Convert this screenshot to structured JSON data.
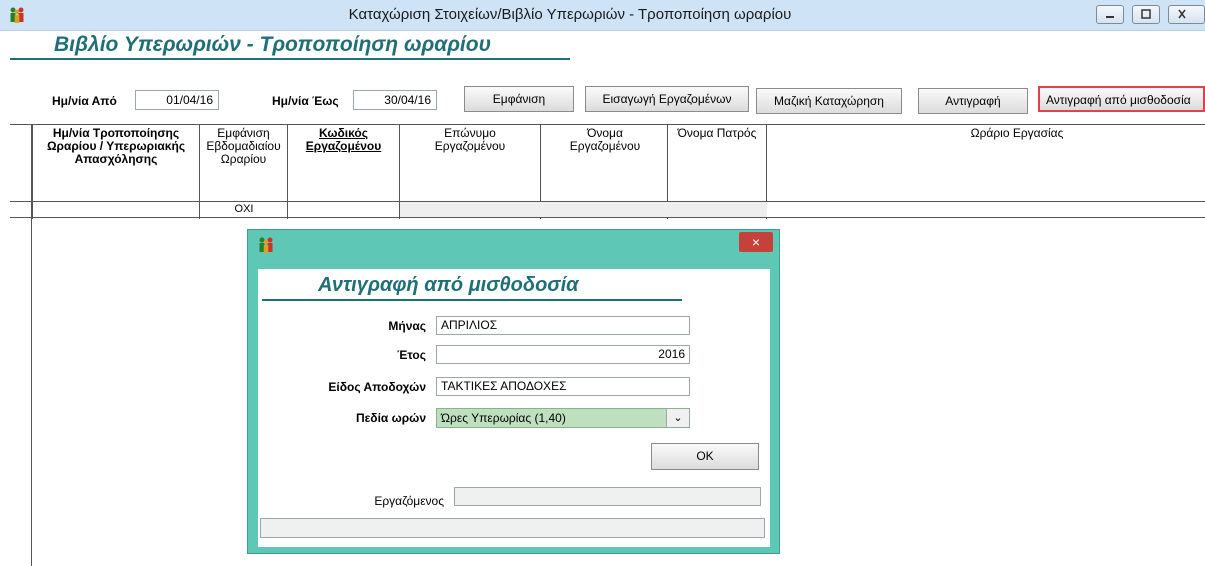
{
  "window": {
    "title": "Καταχώριση Στοιχείων/Βιβλίο Υπερωριών - Τροποποίηση ωραρίου",
    "icon": "people-icon"
  },
  "page_heading": "Βιβλίο Υπερωριών - Τροποποίηση ωραρίου",
  "filters": {
    "date_from_label": "Ημ/νία Από",
    "date_from_value": "01/04/16",
    "date_to_label": "Ημ/νία Έως",
    "date_to_value": "30/04/16"
  },
  "toolbar": {
    "show_label": "Εμφάνιση",
    "import_label": "Εισαγωγή Εργαζομένων",
    "bulk_label": "Μαζική Καταχώρηση",
    "copy_label": "Αντιγραφή",
    "copy_payroll_label": "Αντιγραφή από μισθοδοσία"
  },
  "grid": {
    "columns": [
      "Ημ/νία Τροποποίησης Ωραρίου / Υπερωριακής Απασχόλησης",
      "Εμφάνιση Εβδομαδιαίου Ωραρίου",
      "Κωδικός Εργαζομένου",
      "Επώνυμο Εργαζομένου",
      "Όνομα Εργαζομένου",
      "Όνομα Πατρός",
      "Ωράριο Εργασίας"
    ],
    "row": {
      "weekly_display": "ΟΧΙ"
    }
  },
  "dialog": {
    "close_label": "×",
    "heading": "Αντιγραφή από μισθοδοσία",
    "month_label": "Μήνας",
    "month_value": "ΑΠΡΙΛΙΟΣ",
    "year_label": "Έτος",
    "year_value": "2016",
    "earnings_label": "Είδος Αποδοχών",
    "earnings_value": "ΤΑΚΤΙΚΕΣ ΑΠΟΔΟΧΕΣ",
    "hours_label": "Πεδία ωρών",
    "hours_value": "Ώρες Υπερωρίας (1,40)",
    "ok_label": "OK",
    "employee_label": "Εργαζόμενος"
  },
  "colors": {
    "accent": "#1f6f78",
    "dialog_frame": "#5fc7b6",
    "highlight": "#e0424b"
  }
}
